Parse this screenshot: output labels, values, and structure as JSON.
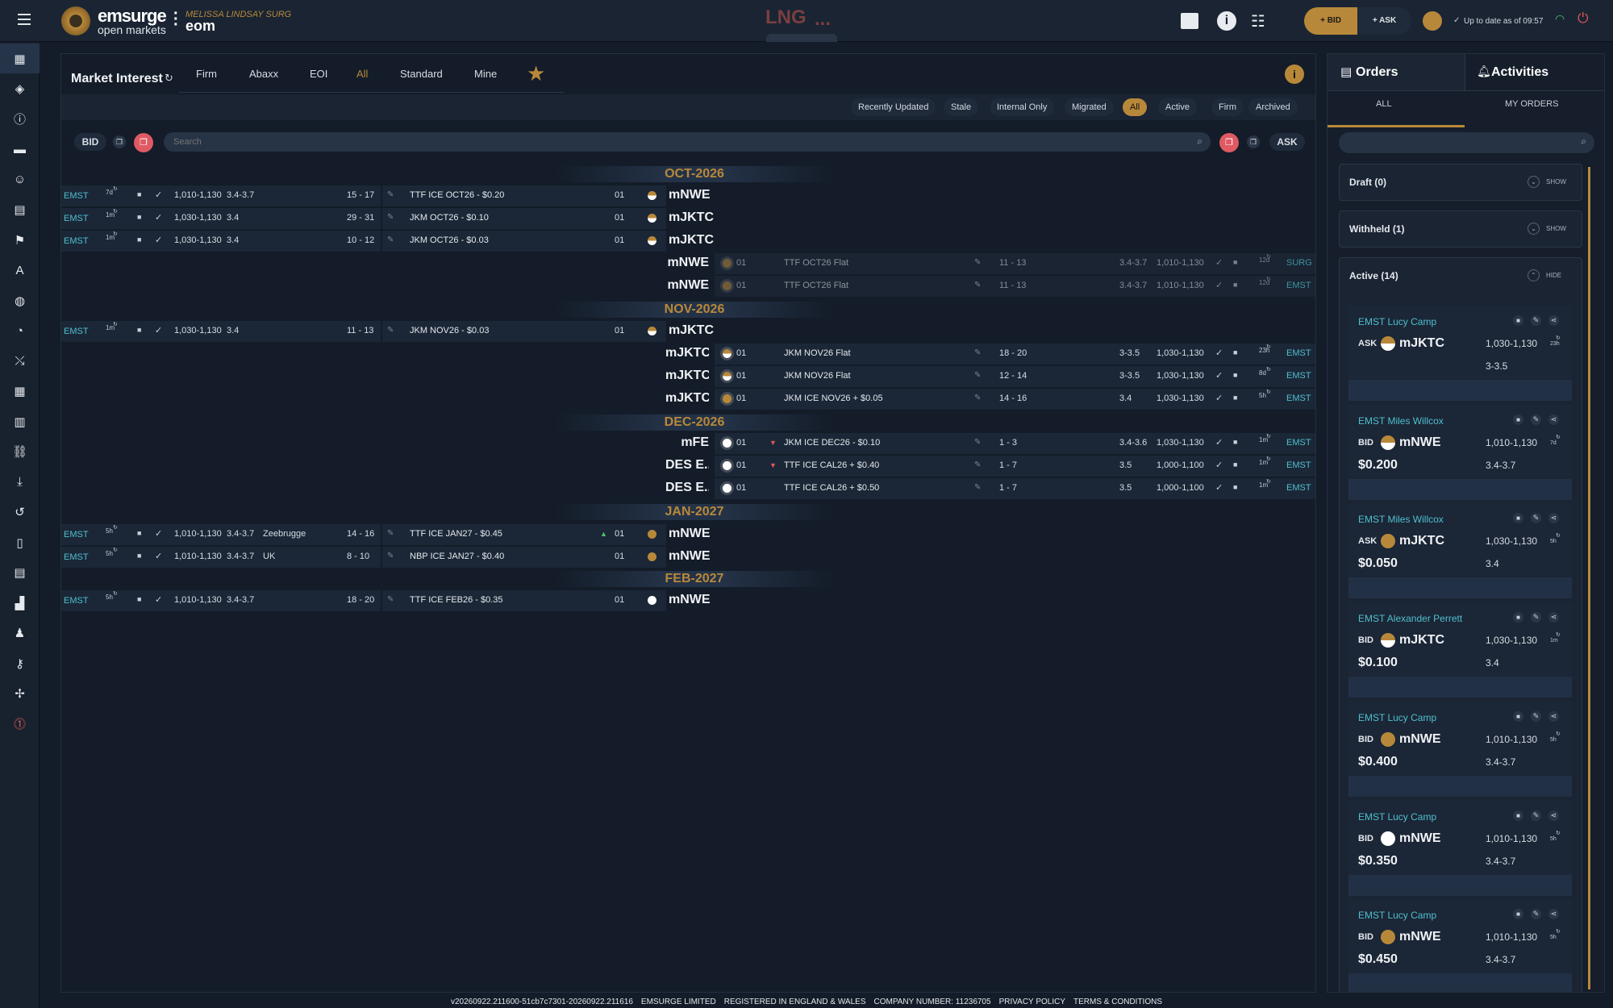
{
  "topbar": {
    "brand_line1": "emsurge",
    "brand_line2": "open markets",
    "brand_short": "eom",
    "user": "MELISSA LINDSAY SURG",
    "market": "LNG",
    "more": "...",
    "bid_label": "BID",
    "ask_label": "ASK",
    "status": "Up to date as of 09:57"
  },
  "nav": {
    "icons": [
      "dashboard-icon",
      "handshake-icon",
      "info-icon",
      "document-icon",
      "users-icon",
      "table-icon",
      "flag-icon",
      "translate-icon",
      "globe-icon",
      "speedometer-icon",
      "chart-icon",
      "grid-icon",
      "layout-icon",
      "link-icon",
      "download-icon",
      "history-icon",
      "mobile-icon",
      "news-icon",
      "factory-icon",
      "person-icon",
      "key-icon",
      "accessibility-icon",
      "alert-icon"
    ]
  },
  "main": {
    "title": "Market Interest",
    "tabs": [
      "Firm",
      "Abaxx",
      "EOI",
      "All",
      "Standard",
      "Mine"
    ],
    "filters": [
      "Recently Updated",
      "Stale",
      "Internal Only",
      "Migrated",
      "All",
      "Active",
      "Firm",
      "Archived"
    ],
    "bid_label": "BID",
    "ask_label": "ASK",
    "search_placeholder": "Search"
  },
  "months": [
    "OCT-2026",
    "NOV-2026",
    "DEC-2026",
    "JAN-2027",
    "FEB-2027"
  ],
  "bids": [
    {
      "org": "EMST",
      "age": "7d",
      "qty": "1,010-1,130",
      "size": "3.4-3.7",
      "loc": "",
      "window": "15 - 17",
      "price": "TTF ICE OCT26 - $0.20",
      "num": "01",
      "product": "mNWE"
    },
    {
      "org": "EMST",
      "age": "1m",
      "qty": "1,030-1,130",
      "size": "3.4",
      "loc": "",
      "window": "29 - 31",
      "price": "JKM OCT26 - $0.10",
      "num": "01",
      "product": "mJKTC"
    },
    {
      "org": "EMST",
      "age": "1m",
      "qty": "1,030-1,130",
      "size": "3.4",
      "loc": "",
      "window": "10 - 12",
      "price": "JKM OCT26 - $0.03",
      "num": "01",
      "product": "mJKTC"
    },
    {
      "org": "EMST",
      "age": "1m",
      "qty": "1,030-1,130",
      "size": "3.4",
      "loc": "",
      "window": "11 - 13",
      "price": "JKM NOV26 - $0.03",
      "num": "01",
      "product": "mJKTC"
    },
    {
      "org": "EMST",
      "age": "5h",
      "qty": "1,010-1,130",
      "size": "3.4-3.7",
      "loc": "Zeebrugge",
      "window": "14 - 16",
      "price": "TTF ICE JAN27 - $0.45",
      "num": "01",
      "product": "mNWE"
    },
    {
      "org": "EMST",
      "age": "5h",
      "qty": "1,010-1,130",
      "size": "3.4-3.7",
      "loc": "UK",
      "window": "8 - 10",
      "price": "NBP ICE JAN27 - $0.40",
      "num": "01",
      "product": "mNWE"
    },
    {
      "org": "EMST",
      "age": "5h",
      "qty": "1,010-1,130",
      "size": "3.4-3.7",
      "loc": "",
      "window": "18 - 20",
      "price": "TTF ICE FEB26 - $0.35",
      "num": "01",
      "product": "mNWE"
    }
  ],
  "asks": [
    {
      "product": "mNWE",
      "num": "01",
      "price": "TTF OCT26 Flat",
      "window": "11 - 13",
      "size": "3.4-3.7",
      "qty": "1,010-1,130",
      "age": "12d",
      "org": "SURG"
    },
    {
      "product": "mNWE",
      "num": "01",
      "price": "TTF OCT26 Flat",
      "window": "11 - 13",
      "size": "3.4-3.7",
      "qty": "1,010-1,130",
      "age": "12d",
      "org": "EMST"
    },
    {
      "product": "mJKTC",
      "num": "01",
      "price": "JKM NOV26 Flat",
      "window": "18 - 20",
      "size": "3-3.5",
      "qty": "1,030-1,130",
      "age": "23h",
      "org": "EMST"
    },
    {
      "product": "mJKTC",
      "num": "01",
      "price": "JKM NOV26 Flat",
      "window": "12 - 14",
      "size": "3-3.5",
      "qty": "1,030-1,130",
      "age": "8d",
      "org": "EMST"
    },
    {
      "product": "mJKTC",
      "num": "01",
      "price": "JKM ICE NOV26 + $0.05",
      "window": "14 - 16",
      "size": "3.4",
      "qty": "1,030-1,130",
      "age": "5h",
      "org": "EMST"
    },
    {
      "product": "mFE",
      "num": "01",
      "price": "JKM ICE DEC26 - $0.10",
      "window": "1 - 3",
      "size": "3.4-3.6",
      "qty": "1,030-1,130",
      "age": "1m",
      "org": "EMST"
    },
    {
      "product": "DES E...",
      "num": "01",
      "price": "TTF ICE CAL26 + $0.40",
      "window": "1 - 7",
      "size": "3.5",
      "qty": "1,000-1,100",
      "age": "1m",
      "org": "EMST"
    },
    {
      "product": "DES E...",
      "num": "01",
      "price": "TTF ICE CAL26 + $0.50",
      "window": "1 - 7",
      "size": "3.5",
      "qty": "1,000-1,100",
      "age": "1m",
      "org": "EMST"
    }
  ],
  "orders": {
    "tab_orders": "Orders",
    "tab_activities": "Activities",
    "sub_all": "ALL",
    "sub_mine": "MY ORDERS",
    "draft": "Draft (0)",
    "withheld": "Withheld (1)",
    "active": "Active (14)",
    "show": "SHOW",
    "hide": "HIDE",
    "cards": [
      {
        "trader": "EMST Lucy Camp",
        "side": "ASK",
        "product": "mJKTC",
        "qty": "1,030-1,130",
        "age": "23h",
        "line2": "",
        "size": "3-3.5"
      },
      {
        "trader": "EMST Miles Willcox",
        "side": "BID",
        "product": "mNWE",
        "qty": "1,010-1,130",
        "age": "7d",
        "line2": "$0.200",
        "size": "3.4-3.7"
      },
      {
        "trader": "EMST Miles Willcox",
        "side": "ASK",
        "product": "mJKTC",
        "qty": "1,030-1,130",
        "age": "5h",
        "line2": "$0.050",
        "size": "3.4"
      },
      {
        "trader": "EMST Alexander Perrett",
        "side": "BID",
        "product": "mJKTC",
        "qty": "1,030-1,130",
        "age": "1m",
        "line2": "$0.100",
        "size": "3.4"
      },
      {
        "trader": "EMST Lucy Camp",
        "side": "BID",
        "product": "mNWE",
        "qty": "1,010-1,130",
        "age": "5h",
        "line2": "$0.400",
        "size": "3.4-3.7"
      },
      {
        "trader": "EMST Lucy Camp",
        "side": "BID",
        "product": "mNWE",
        "qty": "1,010-1,130",
        "age": "5h",
        "line2": "$0.350",
        "size": "3.4-3.7"
      },
      {
        "trader": "EMST Lucy Camp",
        "side": "BID",
        "product": "mNWE",
        "qty": "1,010-1,130",
        "age": "5h",
        "line2": "$0.450",
        "size": "3.4-3.7"
      }
    ]
  },
  "footer": [
    "v20260922.211600-51cb7c7301-20260922.211616",
    "EMSURGE LIMITED",
    "REGISTERED IN ENGLAND & WALES",
    "COMPANY NUMBER: 11236705",
    "PRIVACY POLICY",
    "TERMS & CONDITIONS"
  ]
}
